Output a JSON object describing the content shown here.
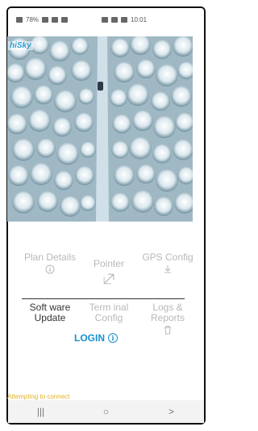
{
  "status_bar": {
    "left_text": "78%",
    "time": "10:01"
  },
  "app": {
    "brand": "hiSky"
  },
  "menu": {
    "plan_details": "Plan Details",
    "pointer": "Pointer",
    "gps_config": "GPS Config",
    "software_update": "Soft ware Update",
    "terminal_config": "Term inal Config",
    "logs_reports": "Logs & Reports"
  },
  "login": {
    "label": "LOGIN"
  },
  "status_message": "Attempting to connect",
  "navbar": {
    "recent": "|||",
    "home": "○",
    "back": ">"
  },
  "colors": {
    "accent": "#1a8ecf",
    "status_text": "#e0b324",
    "disabled": "#b8b8b8"
  }
}
